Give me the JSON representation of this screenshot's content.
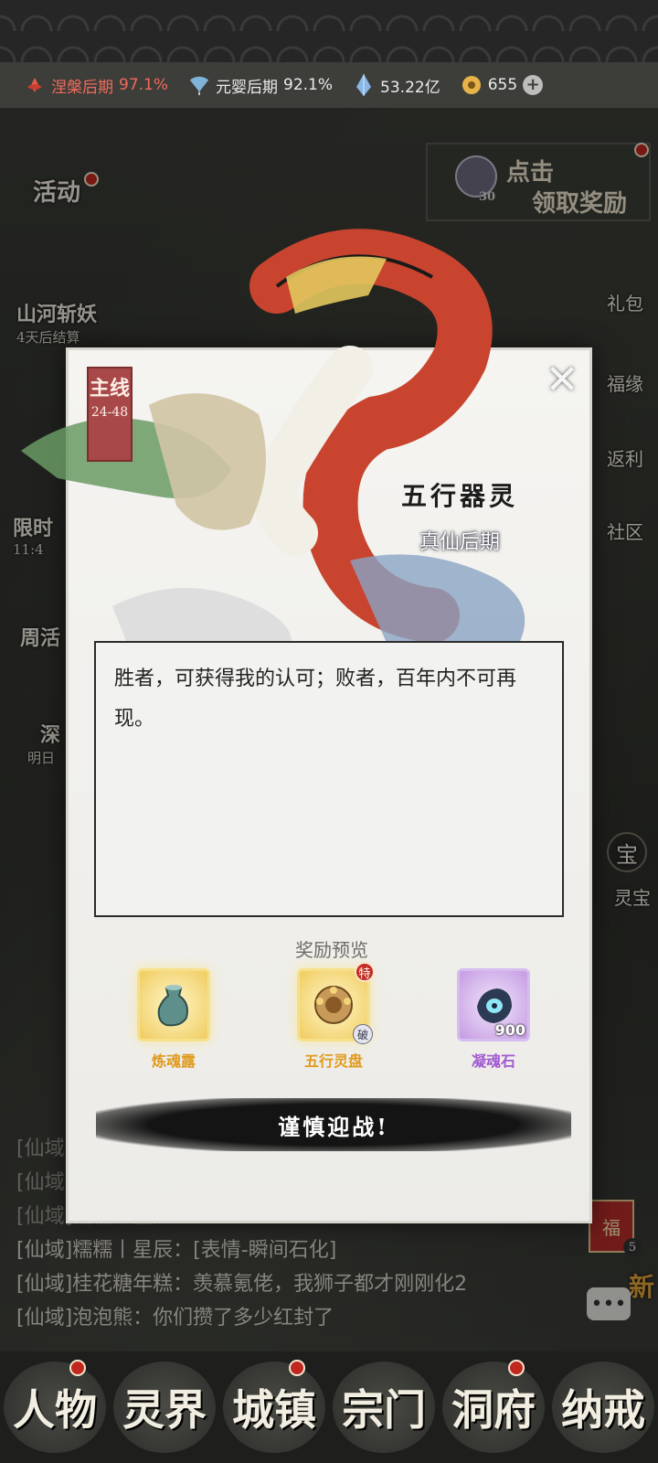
{
  "statusbar": {
    "cultivation_1": {
      "label": "涅槃后期",
      "percent": "97.1%",
      "icon": "lotus-icon"
    },
    "cultivation_2": {
      "label": "元婴后期",
      "percent": "92.1%",
      "icon": "fan-icon"
    },
    "spirit_stones": {
      "value": "53.22亿",
      "icon": "crystal-icon"
    },
    "jade": {
      "value": "655",
      "icon": "jade-coin-icon"
    },
    "add_label": "+"
  },
  "background": {
    "activity_label": "活动",
    "event_1_title": "山河斩妖",
    "event_1_sub": "4天后结算",
    "event_2_title": "限时",
    "event_2_sub": "11:4",
    "event_3_title": "周活",
    "event_4_title": "深",
    "event_4_sub": "明日",
    "claim_line1": "点击",
    "claim_line2": "领取奖励",
    "claim_count": "30",
    "right_items": [
      "礼包",
      "福缘",
      "返利",
      "社区"
    ],
    "treasure_label": "灵宝",
    "treasure_icon_text": "宝",
    "fu_label": "福",
    "fu_count": "5",
    "new_label": "新"
  },
  "chat": [
    "[仙域]",
    "[仙域]",
    "[仙域]糯糯丨星辰：",
    "[仙域]糯糯丨星辰：[表情-瞬间石化]",
    "[仙域]桂花糖年糕：羡慕氪佬，我狮子都才刚刚化2",
    "[仙域]泡泡熊：你们攒了多少红封了"
  ],
  "bottom_nav": [
    "人物",
    "灵界",
    "城镇",
    "宗门",
    "洞府",
    "纳戒"
  ],
  "modal": {
    "chapter_label": "主线",
    "chapter_progress": "24-48",
    "close_label": "✕",
    "boss_name": "五行器灵",
    "boss_rank": "真仙后期",
    "dialog_text": "胜者，可获得我的认可；败者，百年内不可再现。",
    "reward_title": "奖励预览",
    "rewards": [
      {
        "name": "炼魂露",
        "rarity": "gold",
        "icon": "spirit-bottle-icon"
      },
      {
        "name": "五行灵盘",
        "rarity": "gold",
        "icon": "five-elements-disc-icon",
        "tag_top": "特",
        "tag_bottom": "破"
      },
      {
        "name": "凝魂石",
        "rarity": "purple",
        "icon": "soul-stone-icon",
        "quantity": "900"
      }
    ],
    "fight_label": "谨慎迎战!"
  },
  "colors": {
    "red_text": "#ef6b5c",
    "gold_reward": "#e09a1c",
    "purple_reward": "#a259d1",
    "chapter_tag": "#a84848"
  }
}
